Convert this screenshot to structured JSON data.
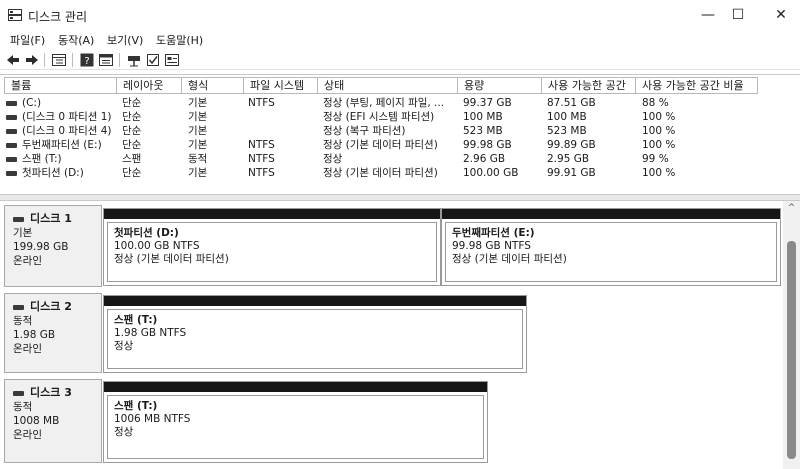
{
  "window": {
    "title": "디스크 관리",
    "icon": "disk-management-icon",
    "minimize_glyph": "—",
    "maximize_glyph": "☐",
    "close_glyph": "✕"
  },
  "menu": [
    "파일(F)",
    "동작(A)",
    "보기(V)",
    "도움말(H)"
  ],
  "toolbar_icons": [
    "back-arrow-icon",
    "forward-arrow-icon",
    "disk-list-icon",
    "help-icon",
    "properties-icon",
    "connect-icon",
    "check-icon",
    "settings-icon"
  ],
  "volume_table": {
    "columns": [
      "볼륨",
      "레이아웃",
      "형식",
      "파일 시스템",
      "상태",
      "용량",
      "사용 가능한 공간",
      "사용 가능한 공간 비율"
    ],
    "rows": [
      {
        "volume": "(C:)",
        "layout": "단순",
        "type": "기본",
        "fs": "NTFS",
        "status": "정상 (부팅, 페이지 파일, ...",
        "capacity": "99.37 GB",
        "free": "87.51 GB",
        "pct": "88 %"
      },
      {
        "volume": "(디스크 0 파티션 1)",
        "layout": "단순",
        "type": "기본",
        "fs": "",
        "status": "정상 (EFI 시스템 파티션)",
        "capacity": "100 MB",
        "free": "100 MB",
        "pct": "100 %"
      },
      {
        "volume": "(디스크 0 파티션 4)",
        "layout": "단순",
        "type": "기본",
        "fs": "",
        "status": "정상 (복구 파티션)",
        "capacity": "523 MB",
        "free": "523 MB",
        "pct": "100 %"
      },
      {
        "volume": "두번째파티션 (E:)",
        "layout": "단순",
        "type": "기본",
        "fs": "NTFS",
        "status": "정상 (기본 데이터 파티션)",
        "capacity": "99.98 GB",
        "free": "99.89 GB",
        "pct": "100 %"
      },
      {
        "volume": "스팬 (T:)",
        "layout": "스팬",
        "type": "동적",
        "fs": "NTFS",
        "status": "정상",
        "capacity": "2.96 GB",
        "free": "2.95 GB",
        "pct": "99 %"
      },
      {
        "volume": "첫파티션 (D:)",
        "layout": "단순",
        "type": "기본",
        "fs": "NTFS",
        "status": "정상 (기본 데이터 파티션)",
        "capacity": "100.00 GB",
        "free": "99.91 GB",
        "pct": "100 %"
      }
    ]
  },
  "disks": [
    {
      "name": "디스크 1",
      "kind": "기본",
      "size": "199.98 GB",
      "state": "온라인",
      "partitions": [
        {
          "name": "첫파티션  (D:)",
          "size": "100.00 GB NTFS",
          "status": "정상 (기본 데이터 파티션)"
        },
        {
          "name": "두번째파티션  (E:)",
          "size": "99.98 GB NTFS",
          "status": "정상 (기본 데이터 파티션)"
        }
      ]
    },
    {
      "name": "디스크 2",
      "kind": "동적",
      "size": "1.98 GB",
      "state": "온라인",
      "partitions": [
        {
          "name": "스팬  (T:)",
          "size": "1.98 GB NTFS",
          "status": "정상"
        }
      ]
    },
    {
      "name": "디스크 3",
      "kind": "동적",
      "size": "1008 MB",
      "state": "온라인",
      "partitions": [
        {
          "name": "스팬  (T:)",
          "size": "1006 MB NTFS",
          "status": "정상"
        }
      ]
    }
  ],
  "scroll_up_glyph": "^"
}
